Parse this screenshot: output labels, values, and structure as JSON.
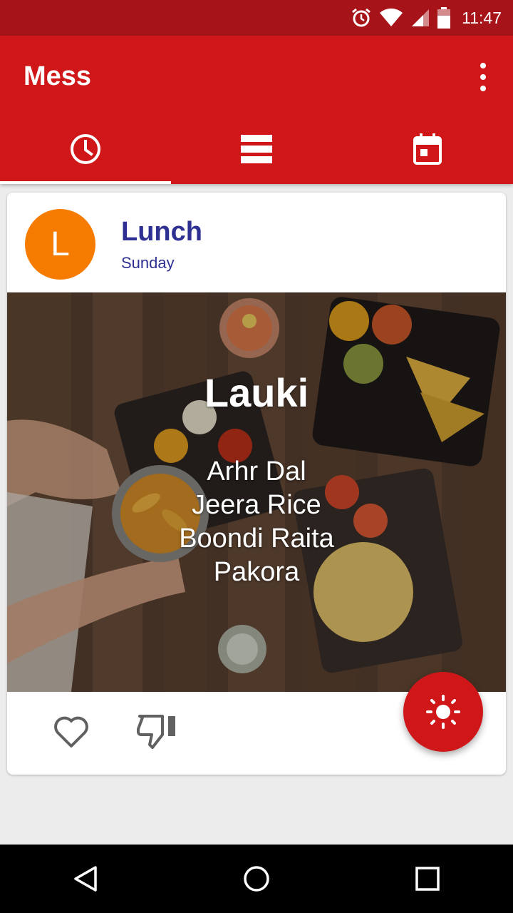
{
  "status_bar": {
    "time": "11:47",
    "icons": [
      "alarm-icon",
      "wifi-icon",
      "signal-icon",
      "battery-icon"
    ]
  },
  "app_bar": {
    "title": "Mess",
    "menu_icon": "overflow-menu-icon",
    "tabs": [
      {
        "icon": "clock-icon",
        "selected": true
      },
      {
        "icon": "list-icon",
        "selected": false
      },
      {
        "icon": "calendar-icon",
        "selected": false
      }
    ]
  },
  "card": {
    "avatar_letter": "L",
    "meal": "Lunch",
    "day": "Sunday",
    "main_dish": "Lauki",
    "side_items": [
      "Arhr Dal",
      "Jeera Rice",
      "Boondi Raita",
      "Pakora"
    ],
    "actions": {
      "like_icon": "heart-icon",
      "dislike_icon": "thumbs-down-icon"
    }
  },
  "fab": {
    "icon": "sun-icon"
  },
  "nav_bar": {
    "icons": [
      "back-icon",
      "home-icon",
      "recents-icon"
    ]
  },
  "colors": {
    "primary": "#cf1719",
    "primary_dark": "#a6141a",
    "avatar": "#f57c00",
    "title_text": "#2e3192"
  }
}
